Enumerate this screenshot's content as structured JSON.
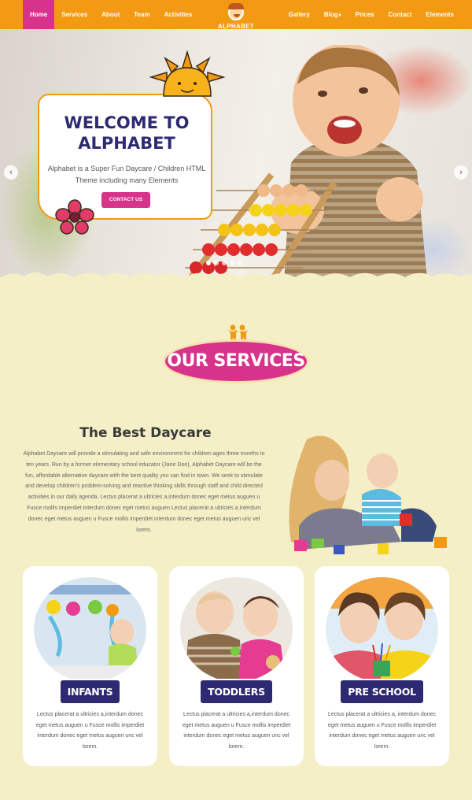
{
  "nav": {
    "left": [
      "Home",
      "Services",
      "About",
      "Team",
      "Activities"
    ],
    "right": [
      "Gallery",
      "Blog",
      "Prices",
      "Contact",
      "Elements"
    ],
    "blog_caret": "▾",
    "logo_text": "ALPHABET"
  },
  "hero": {
    "title_line1": "WELCOME TO",
    "title_line2": "ALPHABET",
    "description": "Alphabet is a Super Fun Daycare / Children HTML Theme including many Elements",
    "button": "CONTACT US",
    "prev": "‹",
    "next": "›",
    "slide_count": 5,
    "active_slide": 1
  },
  "services": {
    "title": "OUR SERVICES"
  },
  "about": {
    "title": "The Best Daycare",
    "text": "Alphabet Daycare will provide a stimulating and safe environment for children ages three months to ten years. Run by a former elementary school educator (Jane Doe), Alphabet Daycare will be the fun, affordable alternative daycare with the best quality you can find in town. We seek to stimulate and develop children’s problem-solving and reactive thinking skills through staff and child directed activities in our daily agenda. Lectus placerat a ultricies a,interdum donec eget metus auguen u Fusce mollis imperdiet interdum donec eget metus auguen Lectus placerat a ultricies a,interdum donec eget metus auguen u Fusce mollis imperdiet interdum donec eget metus auguen unc vel lorem."
  },
  "cards": [
    {
      "label": "INFANTS",
      "text": "Lectus placerat a ultricies a,interdum donec eget metus auguen u Fusce mollis imperdiet interdum donec eget metus auguen unc vel lorem."
    },
    {
      "label": "TODDLERS",
      "text": "Lectus placerat a ultricies a,interdum donec eget metus auguen u Fusce mollis imperdiet interdum donec eget metus auguen unc vel lorem."
    },
    {
      "label": "PRE SCHOOL",
      "text": "Lectus placerat a ultricies a, interdum donec eget metus auguen u Fusce mollis imperdiet interdum donec eget metus auguen unc vel lorem."
    }
  ],
  "colors": {
    "nav": "#f29a12",
    "accent_pink": "#d8338a",
    "navy": "#2e2a72",
    "background": "#f4efc6"
  },
  "icons": [
    "logo-face-icon",
    "sun-icon",
    "flower-icon",
    "kids-icon",
    "chevron-left-icon",
    "chevron-right-icon"
  ]
}
